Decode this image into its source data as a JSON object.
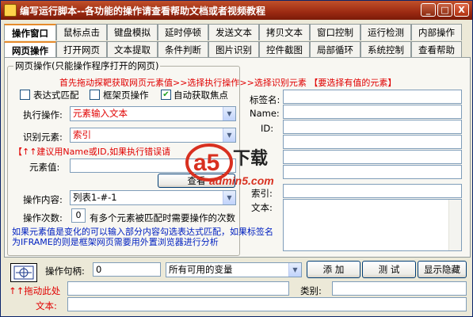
{
  "window": {
    "title": "编写运行脚本--各功能的操作请查看帮助文档或者视频教程",
    "minimize": "_",
    "maximize": "□",
    "close": "X"
  },
  "tabs_row1": [
    "操作窗口",
    "鼠标点击",
    "键盘模拟",
    "延时停顿",
    "发送文本",
    "拷贝文本",
    "窗口控制",
    "运行检测",
    "内部操作"
  ],
  "tabs_row2": [
    "网页操作",
    "打开网页",
    "文本提取",
    "条件判断",
    "图片识别",
    "控件截图",
    "局部循环",
    "系统控制",
    "查看帮助"
  ],
  "group": {
    "title": "网页操作(只能操作程序打开的网页)",
    "hint1": "首先拖动探靶获取网页元素值>>选择执行操作>>选择识别元素 【要选择有值的元素】",
    "chk_regex": "表达式匹配",
    "chk_frame": "框架页操作",
    "chk_focus": "自动获取焦点",
    "exec_label": "执行操作:",
    "exec_value": "元素输入文本",
    "identify_label": "识别元素:",
    "identify_value": "索引",
    "hint2": "【↑↑建议用Name或ID,如果执行错误请",
    "elem_value_label": "元素值:",
    "elem_value": "",
    "check_button": "查看",
    "content_label": "操作内容:",
    "content_value": "列表1-#-1",
    "times_label": "操作次数:",
    "times_value": "0",
    "times_note": "有多个元素被匹配时需要操作的次数",
    "note": "如果元素值是变化的可以输入部分内容勾选表达式匹配，如果标签名为IFRAME的则是框架网页需要用外置浏览器进行分析"
  },
  "right": {
    "tag_label": "标签名:",
    "name_label": "Name:",
    "id_label": "ID:",
    "index_label": "索引:",
    "text_label": "文本:"
  },
  "bottom": {
    "handle_label": "操作句柄:",
    "handle_value": "0",
    "var_select": "所有可用的变量",
    "add_button": "添 加",
    "test_button": "测 试",
    "show_hide_button": "显示隐藏",
    "drag_here": "↑↑拖动此处",
    "category_label": "类别:",
    "text_label": "文本:"
  },
  "watermark": {
    "brand": "下载",
    "url": "admin5.com",
    "mark": "a5"
  }
}
